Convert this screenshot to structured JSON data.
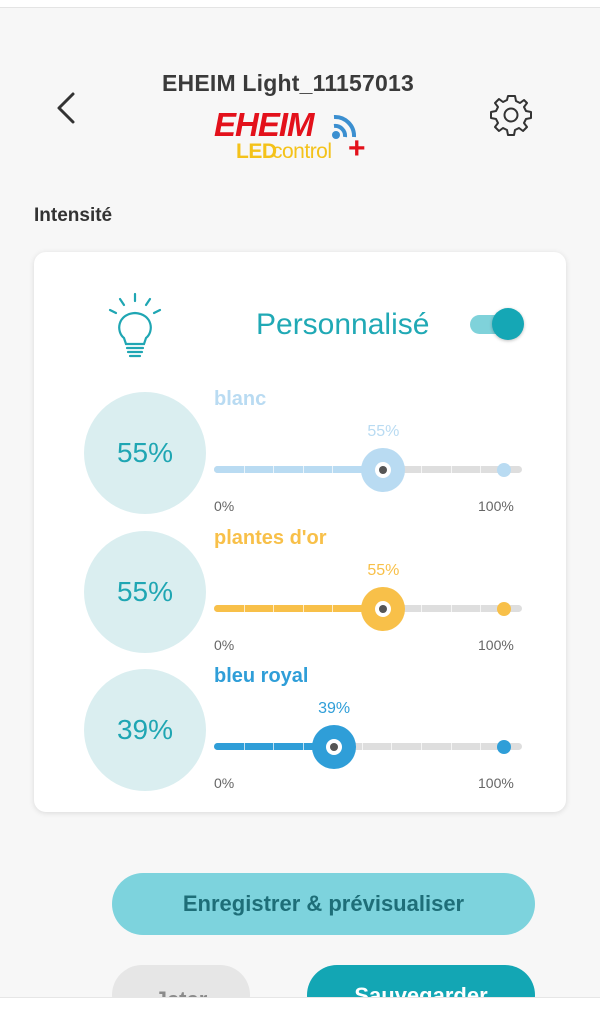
{
  "header": {
    "title": "EHEIM Light_11157013",
    "back_icon": "chevron-left-icon",
    "settings_icon": "gear-icon",
    "logo": {
      "brand": "EHEIM",
      "led": "LED",
      "control": "control",
      "plus": "+"
    }
  },
  "section": {
    "title": "Intensité"
  },
  "card": {
    "mode_label": "Personnalisé",
    "mode_toggle_on": true,
    "channels": [
      {
        "name": "blanc",
        "value": 55,
        "circle_text": "55%",
        "value_text": "55%",
        "color": "#b9dbf2",
        "min_label": "0%",
        "max_label": "100%"
      },
      {
        "name": "plantes d'or",
        "value": 55,
        "circle_text": "55%",
        "value_text": "55%",
        "color": "#f8c049",
        "min_label": "0%",
        "max_label": "100%"
      },
      {
        "name": "bleu royal",
        "value": 39,
        "circle_text": "39%",
        "value_text": "39%",
        "color": "#2f9ed8",
        "min_label": "0%",
        "max_label": "100%"
      }
    ]
  },
  "buttons": {
    "preview": "Enregistrer & prévisualiser",
    "discard": "Jeter",
    "save": "Sauvegarder"
  },
  "colors": {
    "accent": "#13a6b4",
    "accent_light": "#7dd3dd",
    "brand_red": "#e3111b",
    "brand_yellow": "#f4c21a"
  }
}
